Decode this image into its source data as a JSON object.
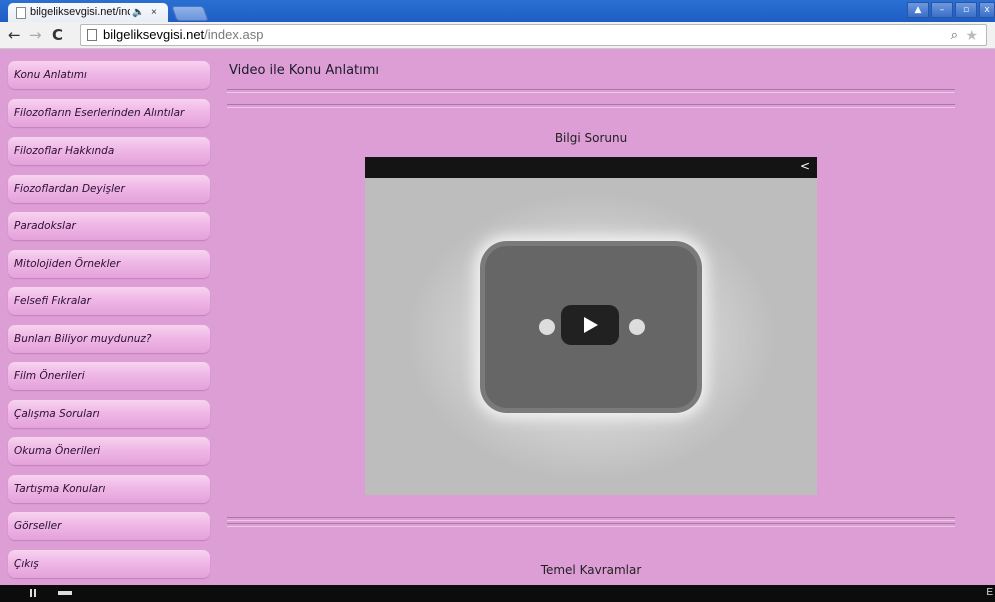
{
  "browser": {
    "tab_title": "bilgeliksevgisi.net/inc",
    "tab_audio_icon": "speaker-icon",
    "tab_close": "×",
    "url_host": "bilgeliksevgisi.net",
    "url_path": "/index.asp",
    "nav_back": "←",
    "nav_forward": "→",
    "nav_reload": "C"
  },
  "sidebar": {
    "items": [
      {
        "label": "Konu Anlatımı"
      },
      {
        "label": "Filozofların Eserlerinden Alıntılar"
      },
      {
        "label": "Filozoflar Hakkında"
      },
      {
        "label": "Fiozoflardan Deyişler"
      },
      {
        "label": "Paradokslar"
      },
      {
        "label": "Mitolojiden Örnekler"
      },
      {
        "label": "Felsefi Fıkralar"
      },
      {
        "label": "Bunları Biliyor muydunuz?"
      },
      {
        "label": "Film Önerileri"
      },
      {
        "label": "Çalışma Soruları"
      },
      {
        "label": "Okuma Önerileri"
      },
      {
        "label": "Tartışma Konuları"
      },
      {
        "label": "Görseller"
      },
      {
        "label": "Çıkış"
      }
    ]
  },
  "main": {
    "title": "Video ile Konu Anlatımı",
    "video_title": "Bilgi Sorunu",
    "second_title": "Temel Kavramlar"
  },
  "colors": {
    "page_background": "#dd9ed6",
    "menu_item": "#efb7e6",
    "chrome_frame": "#2b6fd3"
  },
  "taskbar": {
    "edge_text": "E"
  }
}
